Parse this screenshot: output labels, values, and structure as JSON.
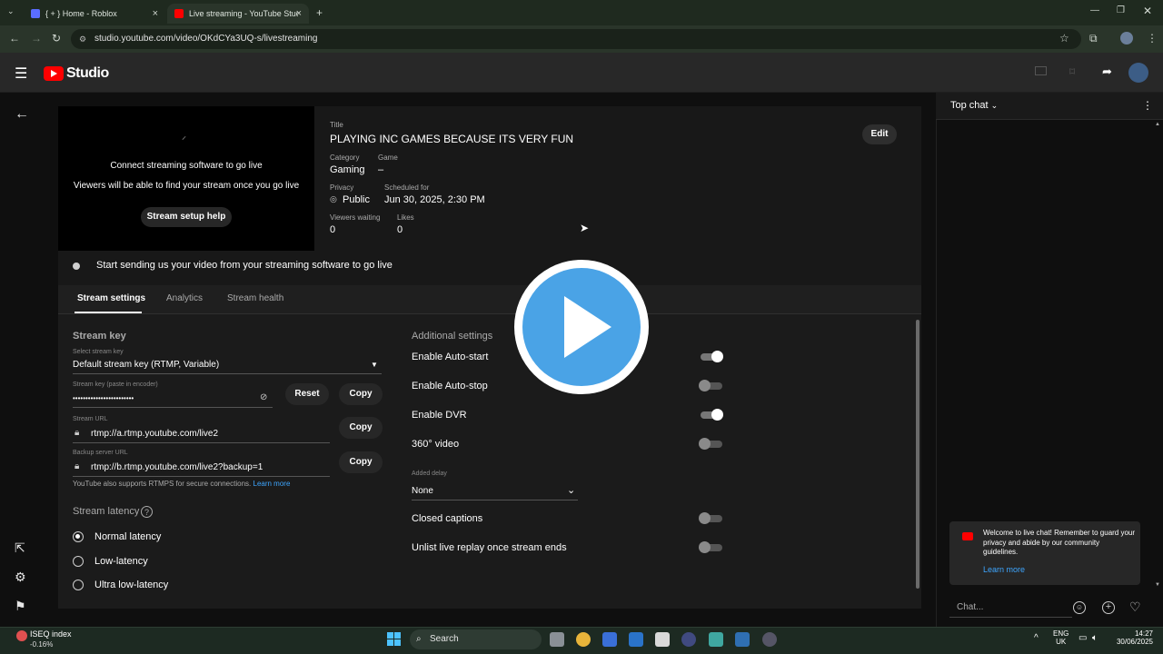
{
  "browser": {
    "tabs": [
      {
        "label": "{ + } Home - Roblox"
      },
      {
        "label": "Live streaming - YouTube Studio"
      }
    ],
    "url": "studio.youtube.com/video/OKdCYa3UQ-s/livestreaming"
  },
  "studio": {
    "logo_text": "Studio"
  },
  "preview": {
    "connect_text": "Connect streaming software to go live",
    "viewers_text": "Viewers will be able to find your stream once you go live",
    "setup_button": "Stream setup help"
  },
  "info": {
    "title_label": "Title",
    "title": "PLAYING INC GAMES BECAUSE ITS VERY FUN",
    "category_label": "Category",
    "category": "Gaming",
    "game_label": "Game",
    "game": "–",
    "privacy_label": "Privacy",
    "privacy": "Public",
    "scheduled_label": "Scheduled for",
    "scheduled": "Jun 30, 2025, 2:30 PM",
    "viewers_label": "Viewers waiting",
    "viewers": "0",
    "likes_label": "Likes",
    "likes": "0",
    "edit_button": "Edit"
  },
  "status": {
    "text": "Start sending us your video from your streaming software to go live"
  },
  "tabs": [
    {
      "label": "Stream settings"
    },
    {
      "label": "Analytics"
    },
    {
      "label": "Stream health"
    }
  ],
  "stream_key": {
    "section_title": "Stream key",
    "select_label": "Select stream key",
    "select_value": "Default stream key (RTMP, Variable)",
    "key_label": "Stream key (paste in encoder)",
    "key_value": "••••••••••••••••••••••••",
    "reset_button": "Reset",
    "copy_button": "Copy",
    "url_label": "Stream URL",
    "url_value": "rtmp://a.rtmp.youtube.com/live2",
    "backup_label": "Backup server URL",
    "backup_value": "rtmp://b.rtmp.youtube.com/live2?backup=1",
    "rtmps_note": "YouTube also supports RTMPS for secure connections.",
    "learn_more": "Learn more"
  },
  "latency": {
    "section_title": "Stream latency",
    "help": "?",
    "options": [
      {
        "label": "Normal latency",
        "selected": true
      },
      {
        "label": "Low-latency",
        "selected": false
      },
      {
        "label": "Ultra low-latency",
        "selected": false
      }
    ]
  },
  "additional": {
    "section_title": "Additional settings",
    "toggles": [
      {
        "label": "Enable Auto-start",
        "on": true
      },
      {
        "label": "Enable Auto-stop",
        "on": false
      },
      {
        "label": "Enable DVR",
        "on": true
      },
      {
        "label": "360° video",
        "on": false
      }
    ],
    "delay_label": "Added delay",
    "delay_value": "None",
    "toggles2": [
      {
        "label": "Closed captions",
        "on": false
      },
      {
        "label": "Unlist live replay once stream ends",
        "on": false
      }
    ]
  },
  "chat": {
    "header": "Top chat",
    "welcome": "Welcome to live chat! Remember to guard your privacy and abide by our community guidelines.",
    "learn_more": "Learn more",
    "placeholder": "Chat..."
  },
  "taskbar": {
    "stock_name": "ISEQ index",
    "stock_change": "-0.16%",
    "search": "Search",
    "lang1": "ENG",
    "lang2": "UK",
    "time": "14:27",
    "date": "30/06/2025"
  },
  "colors": {
    "accent_red": "#ff0000",
    "link_blue": "#3ea6ff",
    "play_overlay": "#4aa3e6"
  }
}
